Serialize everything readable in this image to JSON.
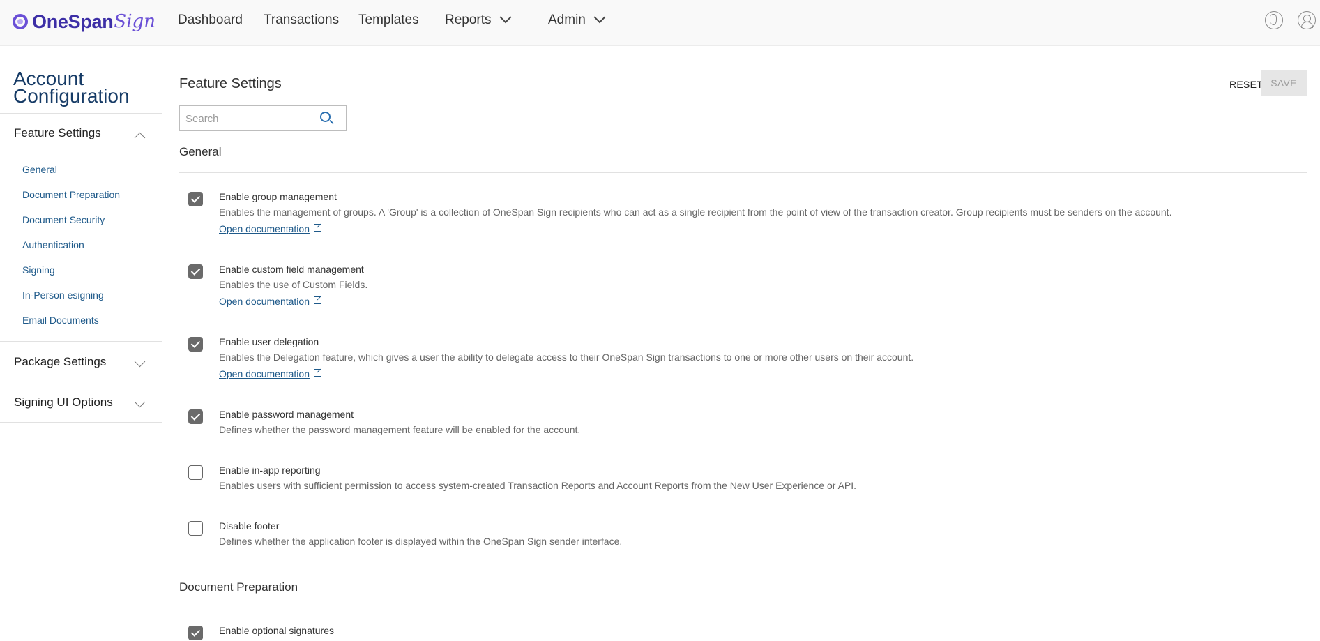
{
  "brand": {
    "name": "OneSpan",
    "script": "Sign"
  },
  "nav": {
    "dashboard": "Dashboard",
    "transactions": "Transactions",
    "templates": "Templates",
    "reports": "Reports",
    "admin": "Admin"
  },
  "sidebar": {
    "title": "Account Configuration",
    "sections": {
      "feature_settings": "Feature Settings",
      "package_settings": "Package Settings",
      "signing_ui_options": "Signing UI Options"
    },
    "items": [
      "General",
      "Document Preparation",
      "Document Security",
      "Authentication",
      "Signing",
      "In-Person esigning",
      "Email Documents"
    ]
  },
  "main": {
    "title": "Feature Settings",
    "reset_label": "RESET",
    "save_label": "SAVE",
    "search_placeholder": "Search",
    "groups": {
      "general": "General",
      "document_preparation": "Document Preparation"
    },
    "link_label": "Open documentation",
    "settings": [
      {
        "title": "Enable group management",
        "desc": "Enables the management of groups. A 'Group' is a collection of OneSpan Sign recipients who can act as a single recipient from the point of view of the transaction creator. Group recipients must be senders on the account.",
        "checked": true,
        "has_link": true
      },
      {
        "title": "Enable custom field management",
        "desc": "Enables the use of Custom Fields.",
        "checked": true,
        "has_link": true
      },
      {
        "title": "Enable user delegation",
        "desc": "Enables the Delegation feature, which gives a user the ability to delegate access to their OneSpan Sign transactions to one or more other users on their account.",
        "checked": true,
        "has_link": true
      },
      {
        "title": "Enable password management",
        "desc": "Defines whether the password management feature will be enabled for the account.",
        "checked": true,
        "has_link": false
      },
      {
        "title": "Enable in-app reporting",
        "desc": "Enables users with sufficient permission to access system-created Transaction Reports and Account Reports from the New User Experience or API.",
        "checked": false,
        "has_link": false
      },
      {
        "title": "Disable footer",
        "desc": "Defines whether the application footer is displayed within the OneSpan Sign sender interface.",
        "checked": false,
        "has_link": false
      },
      {
        "title": "Enable optional signatures",
        "checked": true
      }
    ]
  }
}
